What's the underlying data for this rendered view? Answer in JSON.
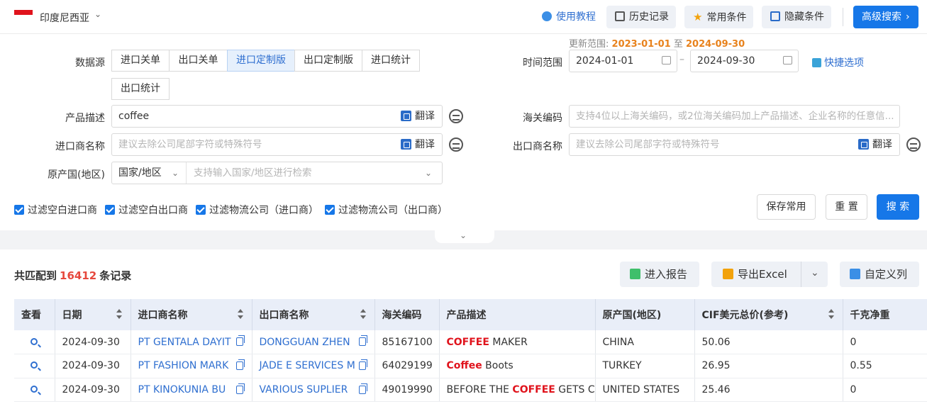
{
  "header": {
    "country": "印度尼西亚",
    "tutorial": "使用教程",
    "history": "历史记录",
    "common": "常用条件",
    "hide": "隐藏条件",
    "advanced": "高级搜索"
  },
  "range": {
    "label": "更新范围:",
    "start": "2023-01-01",
    "to": "至",
    "end": "2024-09-30"
  },
  "form": {
    "datasource_label": "数据源",
    "tabs": [
      "进口关单",
      "出口关单",
      "进口定制版",
      "出口定制版",
      "进口统计",
      "出口统计"
    ],
    "time_label": "时间范围",
    "date_from": "2024-01-01",
    "date_to": "2024-09-30",
    "date_dash": "–",
    "quick": "快捷选项",
    "product_label": "产品描述",
    "product_value": "coffee",
    "translate": "翻译",
    "hs_label": "海关编码",
    "hs_placeholder": "支持4位以上海关编码，或2位海关编码加上产品描述、企业名称的任意信...",
    "importer_label": "进口商名称",
    "importer_placeholder": "建议去除公司尾部字符或特殊符号",
    "exporter_label": "出口商名称",
    "exporter_placeholder": "建议去除公司尾部字符或特殊符号",
    "origin_label": "原产国(地区)",
    "origin_select": "国家/地区",
    "origin_placeholder": "支持输入国家/地区进行检索"
  },
  "filters": [
    "过滤空白进口商",
    "过滤空白出口商",
    "过滤物流公司（进口商）",
    "过滤物流公司（出口商）"
  ],
  "buttons": {
    "save": "保存常用",
    "reset": "重 置",
    "search": "搜 索"
  },
  "results": {
    "prefix": "共匹配到",
    "count": "16412",
    "suffix": "条记录",
    "report": "进入报告",
    "export": "导出Excel",
    "custom": "自定义列"
  },
  "table": {
    "columns": [
      "查看",
      "日期",
      "进口商名称",
      "出口商名称",
      "海关编码",
      "产品描述",
      "原产国(地区)",
      "CIF美元总价(参考)",
      "千克净重"
    ],
    "rows": [
      {
        "date": "2024-09-30",
        "importer": "PT GENTALA DAYIT",
        "exporter": "DONGGUAN ZHEN",
        "hs": "85167100",
        "desc_hl": "COFFEE",
        "desc_pre": "",
        "desc_post": " MAKER",
        "origin": "CHINA",
        "cif": "50.06",
        "kg": "0"
      },
      {
        "date": "2024-09-30",
        "importer": "PT FASHION MARK",
        "exporter": "JADE E SERVICES M",
        "hs": "64029199",
        "desc_hl": "Coffee",
        "desc_pre": "",
        "desc_post": " Boots",
        "origin": "TURKEY",
        "cif": "26.95",
        "kg": "0.55"
      },
      {
        "date": "2024-09-30",
        "importer": "PT KINOKUNIA BU",
        "exporter": "VARIOUS SUPLIER",
        "hs": "49019990",
        "desc_hl": "COFFEE",
        "desc_pre": "BEFORE THE ",
        "desc_post": " GETS COL",
        "origin": "UNITED STATES",
        "cif": "25.46",
        "kg": "0"
      }
    ]
  },
  "colors": {
    "accent": "#1677e8",
    "highlight": "#e0131c",
    "date_orange": "#e8821c"
  }
}
